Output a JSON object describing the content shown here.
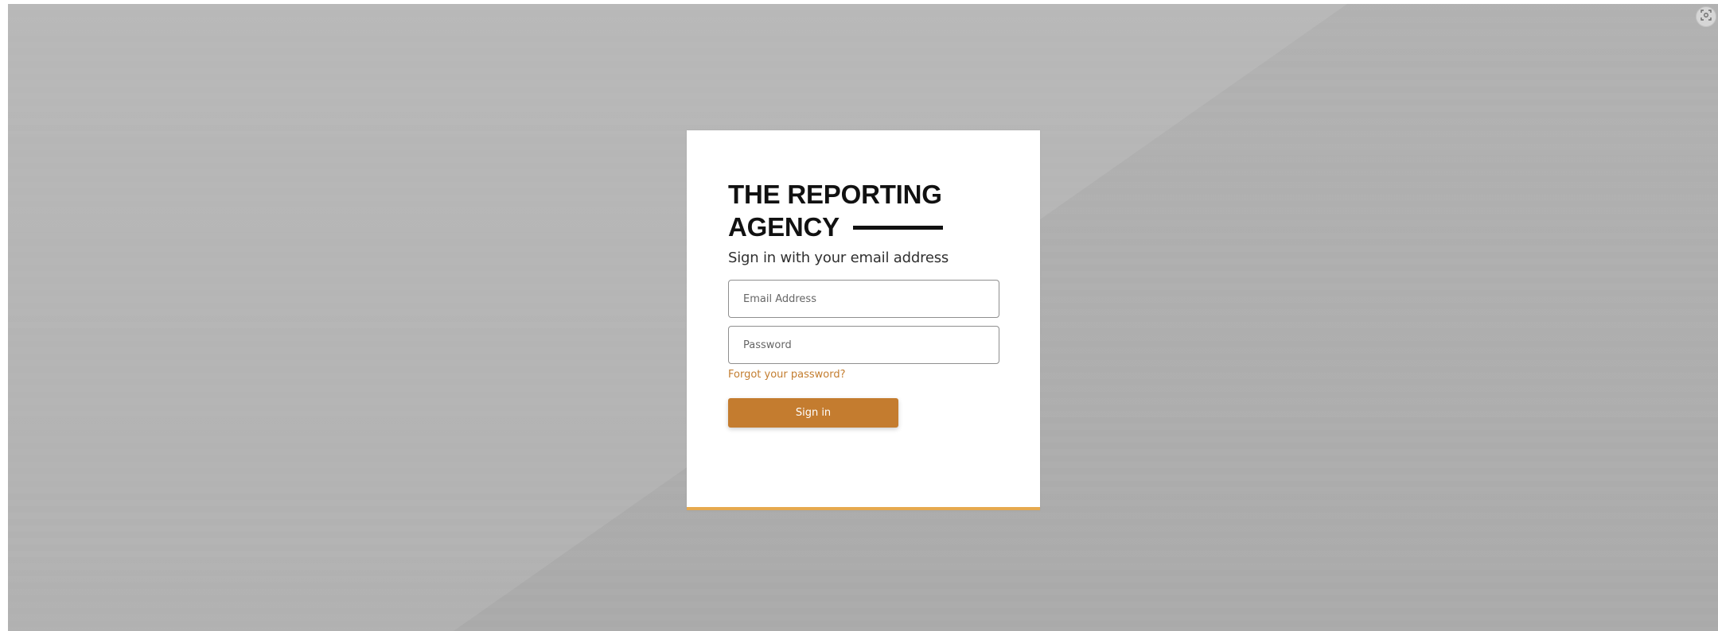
{
  "brand": {
    "line1": "THE REPORTING",
    "line2": "AGENCY"
  },
  "login": {
    "heading": "Sign in with your email address",
    "email_placeholder": "Email Address",
    "password_placeholder": "Password",
    "forgot_label": "Forgot your password?",
    "submit_label": "Sign in"
  },
  "icons": {
    "corner_button": "screen-capture-icon"
  },
  "colors": {
    "accent": "#c47c2f",
    "card_bottom_border": "#e6a94e",
    "background": "#adadad"
  }
}
